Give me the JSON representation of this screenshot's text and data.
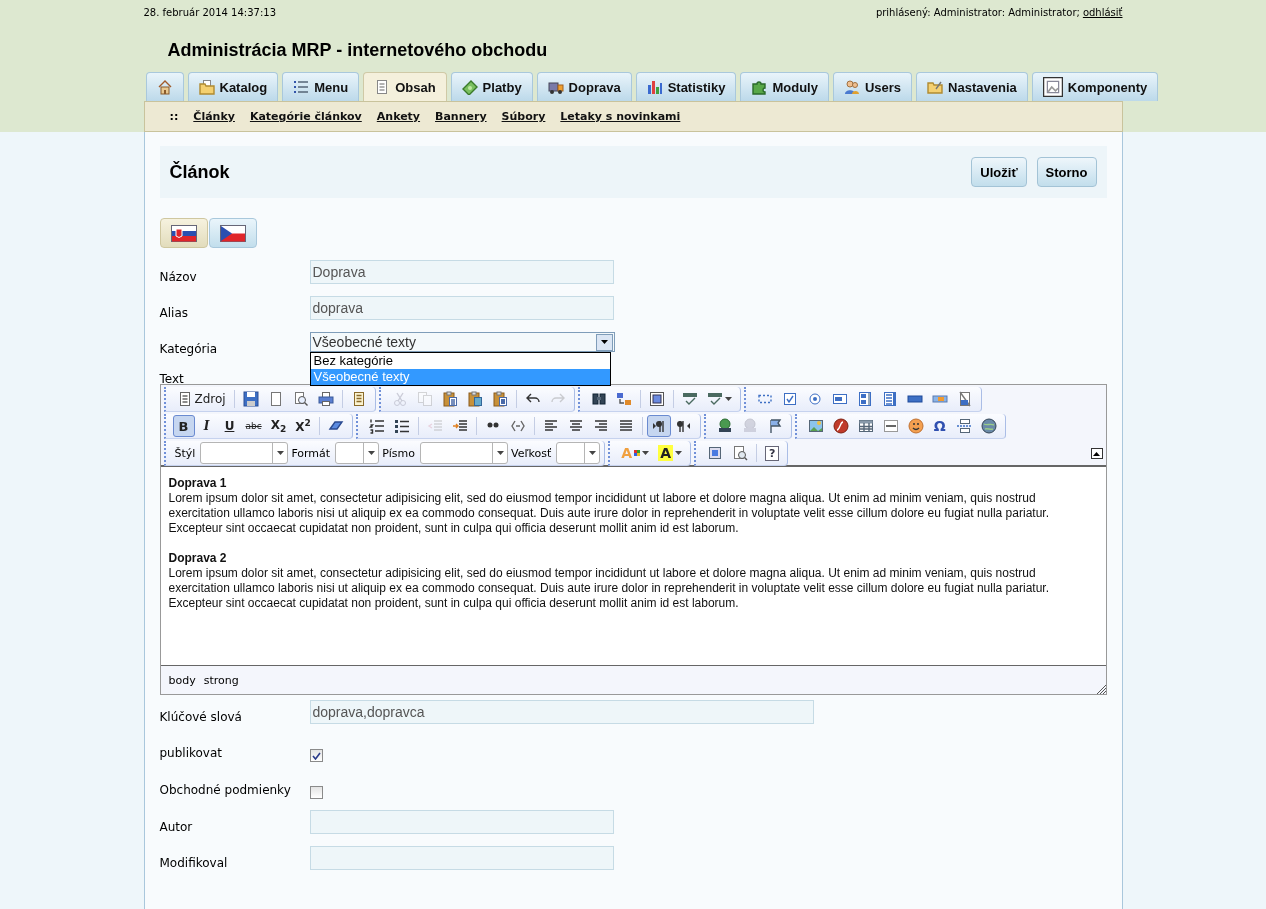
{
  "header": {
    "datetime": "28. február 2014 14:37:13",
    "login_label": "prihlásený: Administrator: Administrator;",
    "logout_link": "odhlásiť",
    "title": "Administrácia MRP - internetového obchodu"
  },
  "tabs": [
    {
      "kind": "home",
      "selected": false
    },
    {
      "kind": "text",
      "label": "Katalog",
      "selected": false
    },
    {
      "kind": "text",
      "label": "Menu",
      "selected": false
    },
    {
      "kind": "text",
      "label": "Obsah",
      "selected": true
    },
    {
      "kind": "text",
      "label": "Platby",
      "selected": false
    },
    {
      "kind": "text",
      "label": "Doprava",
      "selected": false
    },
    {
      "kind": "text",
      "label": "Statistiky",
      "selected": false
    },
    {
      "kind": "text",
      "label": "Moduly",
      "selected": false
    },
    {
      "kind": "text",
      "label": "Users",
      "selected": false
    },
    {
      "kind": "text",
      "label": "Nastavenia",
      "selected": false
    },
    {
      "kind": "text",
      "label": "Komponenty",
      "selected": false
    }
  ],
  "subnav": {
    "marker": "::",
    "links": [
      "Články",
      "Kategórie článkov",
      "Ankety",
      "Bannery",
      "Súbory",
      "Letaky s novinkami"
    ]
  },
  "page": {
    "title": "Článok",
    "buttons": [
      "Uložiť",
      "Storno"
    ]
  },
  "languages": [
    {
      "selected": true
    },
    {
      "selected": false
    }
  ],
  "form": [
    {
      "kind": "text",
      "label": "Názov",
      "value": "Doprava"
    },
    {
      "kind": "text",
      "label": "Alias",
      "value": "doprava"
    },
    {
      "kind": "select",
      "label": "Kategória",
      "value": "Všeobecné texty",
      "expanded": true,
      "options": [
        {
          "label": "Bez kategórie",
          "selected": false
        },
        {
          "label": "Všeobecné texty",
          "selected": true
        }
      ]
    },
    {
      "kind": "editor",
      "label": "Text"
    },
    {
      "kind": "long-text",
      "label": "Klúčové slová",
      "value": "doprava,dopravca"
    },
    {
      "kind": "checkbox",
      "label": "publikovat",
      "checked": true
    },
    {
      "kind": "checkbox",
      "label": "Obchodné podmienky",
      "checked": false
    },
    {
      "kind": "text",
      "label": "Autor"
    },
    {
      "kind": "text",
      "label": "Modifikoval"
    }
  ],
  "editor": {
    "toolbar": [
      {
        "groups": [
          {
            "clusters": [
              [
                {
                  "kind": "labeled",
                  "text": "Zdroj",
                  "pressed": false,
                  "disabled": false
                }
              ],
              [
                {
                  "kind": "icon",
                  "pressed": false,
                  "disabled": false
                },
                {
                  "kind": "icon",
                  "pressed": false,
                  "disabled": false
                },
                {
                  "kind": "icon",
                  "pressed": false,
                  "disabled": false
                },
                {
                  "kind": "icon",
                  "pressed": false,
                  "disabled": false
                }
              ],
              [
                {
                  "kind": "icon",
                  "pressed": false,
                  "disabled": false
                }
              ]
            ]
          },
          {
            "clusters": [
              [
                {
                  "kind": "icon",
                  "pressed": false,
                  "disabled": true
                },
                {
                  "kind": "icon",
                  "pressed": false,
                  "disabled": true
                },
                {
                  "kind": "icon",
                  "pressed": false,
                  "disabled": false
                },
                {
                  "kind": "icon",
                  "pressed": false,
                  "disabled": false
                },
                {
                  "kind": "icon",
                  "pressed": false,
                  "disabled": false
                }
              ],
              [
                {
                  "kind": "icon",
                  "pressed": false,
                  "disabled": false
                },
                {
                  "kind": "icon",
                  "pressed": false,
                  "disabled": true
                }
              ]
            ]
          },
          {
            "clusters": [
              [
                {
                  "kind": "icon",
                  "pressed": false,
                  "disabled": false
                },
                {
                  "kind": "icon",
                  "pressed": false,
                  "disabled": false
                }
              ],
              [
                {
                  "kind": "icon",
                  "pressed": false,
                  "disabled": false
                }
              ],
              [
                {
                  "kind": "icon",
                  "pressed": false,
                  "disabled": false
                },
                {
                  "kind": "icon-menu",
                  "pressed": false,
                  "disabled": false
                }
              ]
            ]
          },
          {
            "clusters": [
              [
                {
                  "kind": "icon",
                  "pressed": false,
                  "disabled": false
                },
                {
                  "kind": "icon",
                  "pressed": false,
                  "disabled": false
                },
                {
                  "kind": "icon",
                  "pressed": false,
                  "disabled": false
                },
                {
                  "kind": "icon",
                  "pressed": false,
                  "disabled": false
                },
                {
                  "kind": "icon",
                  "pressed": false,
                  "disabled": false
                },
                {
                  "kind": "icon",
                  "pressed": false,
                  "disabled": false
                },
                {
                  "kind": "icon",
                  "pressed": false,
                  "disabled": false
                },
                {
                  "kind": "icon",
                  "pressed": false,
                  "disabled": false
                },
                {
                  "kind": "icon",
                  "pressed": false,
                  "disabled": false
                }
              ]
            ]
          }
        ]
      },
      {
        "groups": [
          {
            "clusters": [
              [
                {
                  "kind": "glyph",
                  "text": "B",
                  "pressed": true,
                  "disabled": false
                },
                {
                  "kind": "glyph",
                  "text": "I",
                  "pressed": false,
                  "disabled": false
                },
                {
                  "kind": "glyph",
                  "text": "U",
                  "pressed": false,
                  "disabled": false
                },
                {
                  "kind": "glyph",
                  "text": "abc",
                  "pressed": false,
                  "disabled": false
                },
                {
                  "kind": "glyph",
                  "text": "X$_{2}$",
                  "pressed": false,
                  "disabled": false
                },
                {
                  "kind": "glyph",
                  "text": "X$^{2}$",
                  "pressed": false,
                  "disabled": false
                }
              ],
              [
                {
                  "kind": "icon",
                  "pressed": false,
                  "disabled": false
                }
              ]
            ]
          },
          {
            "clusters": [
              [
                {
                  "kind": "icon",
                  "pressed": false,
                  "disabled": false
                },
                {
                  "kind": "icon",
                  "pressed": false,
                  "disabled": false
                }
              ],
              [
                {
                  "kind": "icon",
                  "pressed": false,
                  "disabled": true
                },
                {
                  "kind": "icon",
                  "pressed": false,
                  "disabled": false
                }
              ],
              [
                {
                  "kind": "icon",
                  "pressed": false,
                  "disabled": false
                },
                {
                  "kind": "icon",
                  "pressed": false,
                  "disabled": false
                }
              ],
              [
                {
                  "kind": "icon",
                  "pressed": false,
                  "disabled": false
                },
                {
                  "kind": "icon",
                  "pressed": false,
                  "disabled": false
                },
                {
                  "kind": "icon",
                  "pressed": false,
                  "disabled": false
                },
                {
                  "kind": "icon",
                  "pressed": false,
                  "disabled": false
                }
              ],
              [
                {
                  "kind": "icon",
                  "pressed": true,
                  "disabled": false
                },
                {
                  "kind": "icon",
                  "pressed": false,
                  "disabled": false
                }
              ]
            ]
          },
          {
            "clusters": [
              [
                {
                  "kind": "icon",
                  "pressed": false,
                  "disabled": false
                },
                {
                  "kind": "icon",
                  "pressed": false,
                  "disabled": true
                },
                {
                  "kind": "icon",
                  "pressed": false,
                  "disabled": false
                }
              ]
            ]
          },
          {
            "clusters": [
              [
                {
                  "kind": "icon",
                  "pressed": false,
                  "disabled": false
                },
                {
                  "kind": "icon",
                  "pressed": false,
                  "disabled": false
                },
                {
                  "kind": "icon",
                  "pressed": false,
                  "disabled": false
                },
                {
                  "kind": "icon",
                  "pressed": false,
                  "disabled": false
                },
                {
                  "kind": "icon",
                  "pressed": false,
                  "disabled": false
                },
                {
                  "kind": "glyph",
                  "text": "Ω",
                  "pressed": false,
                  "disabled": false
                },
                {
                  "kind": "icon",
                  "pressed": false,
                  "disabled": false
                },
                {
                  "kind": "icon",
                  "pressed": false,
                  "disabled": false
                }
              ]
            ]
          }
        ]
      },
      {
        "groups": [
          {
            "clusters": [
              [
                {
                  "kind": "combo",
                  "label": "Štýl"
                },
                {
                  "kind": "combo",
                  "label": "Formát"
                },
                {
                  "kind": "combo",
                  "label": "Písmo"
                },
                {
                  "kind": "combo",
                  "label": "Veľkosť"
                }
              ]
            ]
          },
          {
            "clusters": [
              [
                {
                  "kind": "glyph-menu",
                  "text": "A",
                  "pressed": false,
                  "disabled": false
                },
                {
                  "kind": "glyph-menu",
                  "text": "A",
                  "pressed": false,
                  "disabled": false
                }
              ]
            ]
          },
          {
            "clusters": [
              [
                {
                  "kind": "icon",
                  "pressed": false,
                  "disabled": false
                },
                {
                  "kind": "icon",
                  "pressed": false,
                  "disabled": false
                }
              ],
              [
                {
                  "kind": "glyph",
                  "text": "?",
                  "pressed": false,
                  "disabled": false
                }
              ]
            ]
          }
        ]
      }
    ],
    "content": [
      {
        "heading": "Doprava 1",
        "body": "Lorem ipsum dolor sit amet, consectetur adipisicing elit, sed do eiusmod tempor incididunt ut labore et dolore magna aliqua. Ut enim ad minim veniam, quis nostrud exercitation ullamco laboris nisi ut aliquip ex ea commodo consequat. Duis aute irure dolor in reprehenderit in voluptate velit esse cillum dolore eu fugiat nulla pariatur. Excepteur sint occaecat cupidatat non proident, sunt in culpa qui officia deserunt mollit anim id est laborum."
      },
      {
        "heading": "Doprava 2",
        "body": "Lorem ipsum dolor sit amet, consectetur adipisicing elit, sed do eiusmod tempor incididunt ut labore et dolore magna aliqua. Ut enim ad minim veniam, quis nostrud exercitation ullamco laboris nisi ut aliquip ex ea commodo consequat. Duis aute irure dolor in reprehenderit in voluptate velit esse cillum dolore eu fugiat nulla pariatur. Excepteur sint occaecat cupidatat non proident, sunt in culpa qui officia deserunt mollit anim id est laborum."
      }
    ],
    "path": [
      "body",
      "strong"
    ]
  }
}
